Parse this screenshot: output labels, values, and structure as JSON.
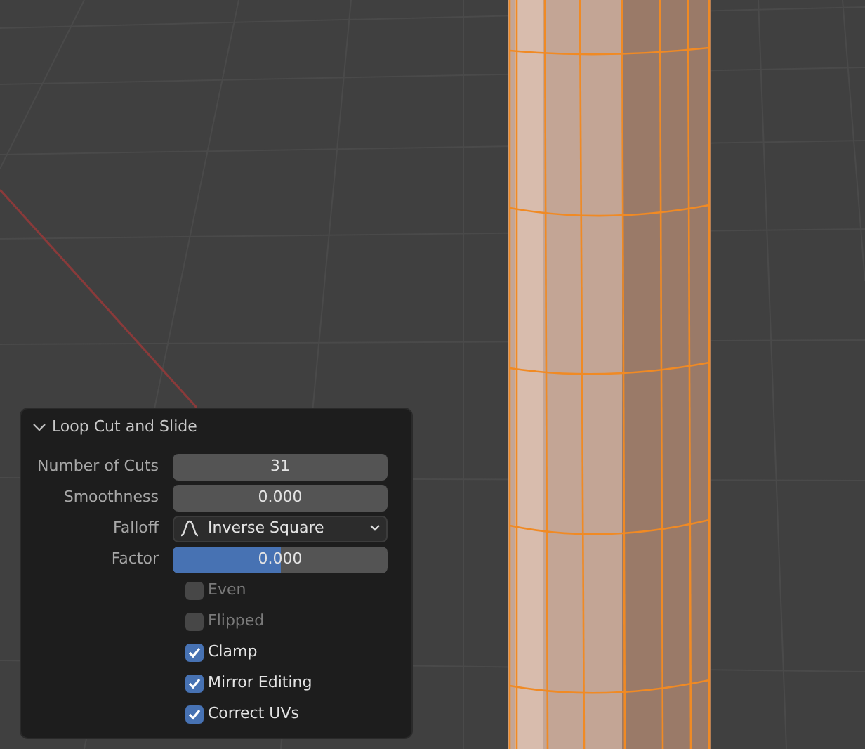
{
  "panel": {
    "title": "Loop Cut and Slide",
    "expanded": true,
    "properties": [
      {
        "kind": "number",
        "label": "Number of Cuts",
        "value": "31"
      },
      {
        "kind": "number",
        "label": "Smoothness",
        "value": "0.000"
      },
      {
        "kind": "dropdown",
        "label": "Falloff",
        "value": "Inverse Square"
      },
      {
        "kind": "slider",
        "label": "Factor",
        "value": "0.000",
        "level": 0.5
      },
      {
        "kind": "checkbox",
        "label": "Even",
        "checked": false,
        "disabled": true
      },
      {
        "kind": "checkbox",
        "label": "Flipped",
        "checked": false,
        "disabled": true
      },
      {
        "kind": "checkbox",
        "label": "Clamp",
        "checked": true,
        "disabled": false
      },
      {
        "kind": "checkbox",
        "label": "Mirror Editing",
        "checked": true,
        "disabled": false
      },
      {
        "kind": "checkbox",
        "label": "Correct UVs",
        "checked": true,
        "disabled": false
      }
    ]
  }
}
